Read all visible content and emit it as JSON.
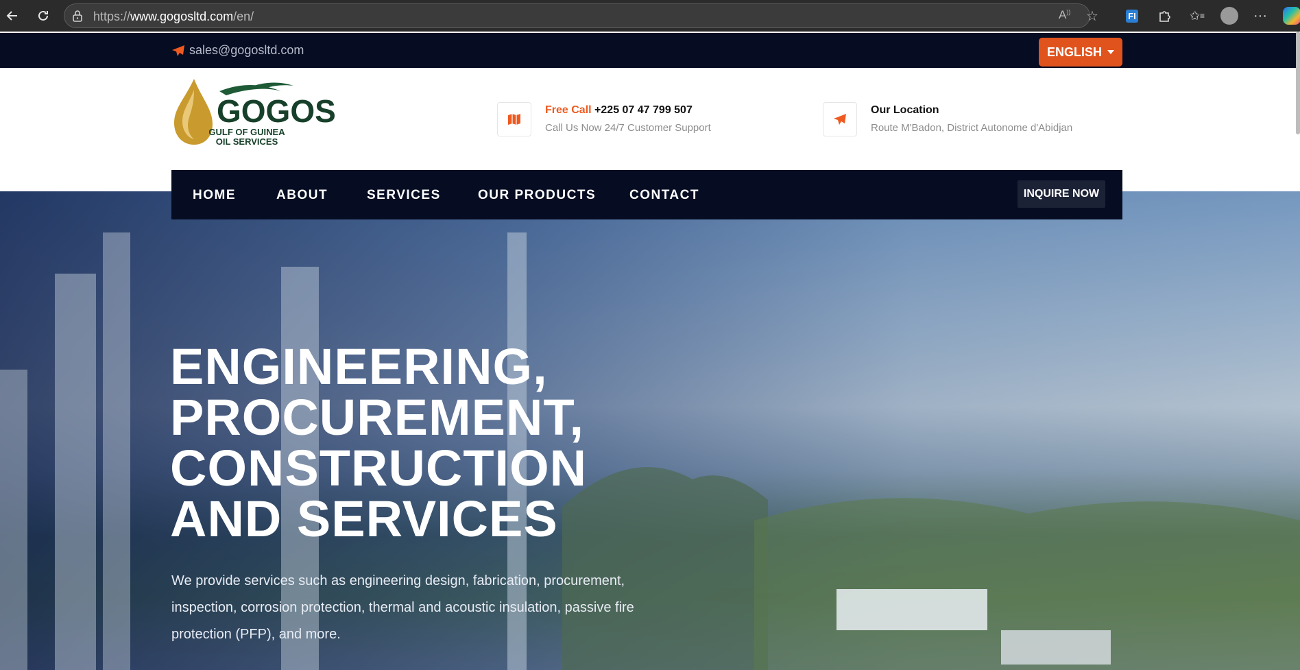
{
  "browser": {
    "url_scheme": "https://",
    "url_host": "www.gogosltd.com",
    "url_path": "/en/",
    "extension_label": "FI"
  },
  "topbar": {
    "email": "sales@gogosltd.com",
    "language": "ENGLISH"
  },
  "header": {
    "logo_name": "GOGOS",
    "logo_sub_line1": "GULF OF GUINEA",
    "logo_sub_line2": "OIL SERVICES",
    "call": {
      "label": "Free Call",
      "number": "+225 07 47 799 507",
      "subtitle": "Call Us Now 24/7 Customer Support"
    },
    "location": {
      "title": "Our Location",
      "subtitle": "Route M'Badon, District Autonome d'Abidjan"
    }
  },
  "nav": {
    "items": [
      "HOME",
      "ABOUT",
      "SERVICES",
      "OUR PRODUCTS",
      "CONTACT"
    ],
    "cta": "INQUIRE NOW"
  },
  "hero": {
    "title_lines": [
      "ENGINEERING,",
      "PROCUREMENT,",
      "CONSTRUCTION",
      "AND SERVICES"
    ],
    "description": "We provide services such as engineering design, fabrication, procurement, inspection, corrosion protection, thermal and acoustic insulation, passive fire protection (PFP), and more."
  },
  "colors": {
    "accent": "#e0531d",
    "navy": "#060c22",
    "logo_green": "#17402a",
    "logo_gold": "#c99a2e"
  },
  "icons": [
    "back-arrow-icon",
    "reload-icon",
    "lock-icon",
    "read-aloud-icon",
    "star-icon",
    "puzzle-icon",
    "favorites-icon",
    "profile-icon",
    "more-icon",
    "copilot-icon",
    "paper-plane-icon",
    "map-icon",
    "caret-down-icon"
  ]
}
